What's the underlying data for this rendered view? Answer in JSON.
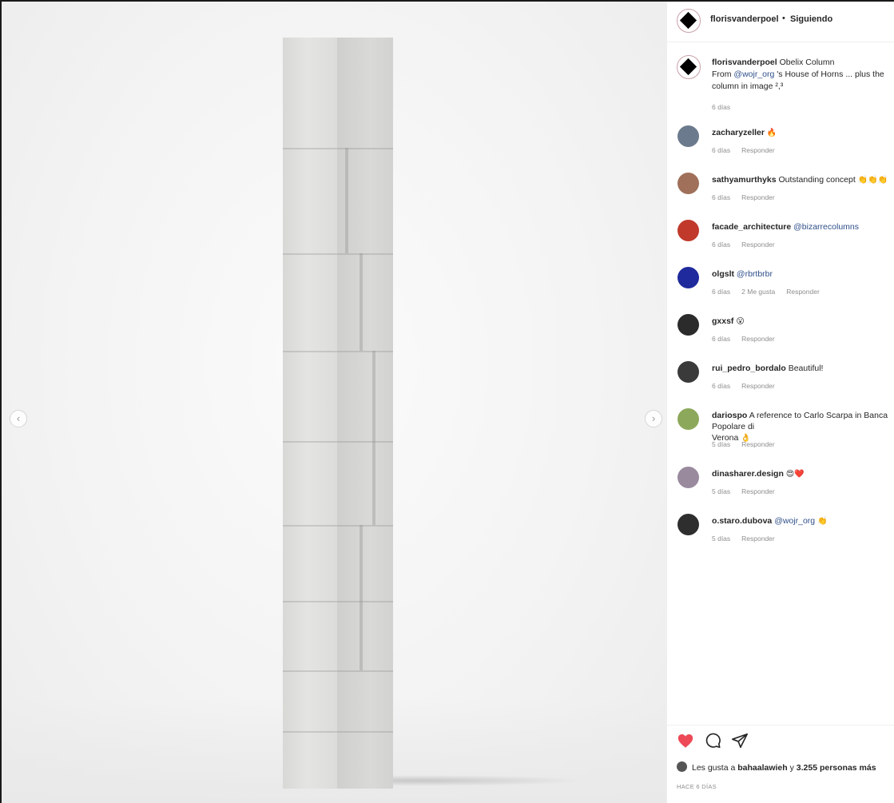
{
  "post": {
    "header": {
      "username": "florisvanderpoel",
      "separator": "•",
      "follow_status": "Siguiendo"
    },
    "caption": {
      "username": "florisvanderpoel",
      "title": "Obelix Column",
      "line2_prefix": "From ",
      "mention": "@wojr_org",
      "line2_rest": " 's House of Horns ... plus the",
      "line3": "column in image ²,³",
      "time": "6 días"
    },
    "comments": [
      {
        "username": "zacharyzeller",
        "text": "",
        "emoji": "🔥",
        "time": "6 días",
        "likes": "",
        "reply": "Responder",
        "avatar_color": "#6b7a8c"
      },
      {
        "username": "sathyamurthyks",
        "text": "Outstanding concept",
        "emoji": "👏👏👏",
        "time": "6 días",
        "likes": "",
        "reply": "Responder",
        "avatar_color": "#a0705a"
      },
      {
        "username": "facade_architecture",
        "text": "",
        "mention": "@bizarrecolumns",
        "time": "6 días",
        "likes": "",
        "reply": "Responder",
        "avatar_color": "#c0392b"
      },
      {
        "username": "olgslt",
        "text": "",
        "mention": "@rbrtbrbr",
        "time": "6 días",
        "likes": "2 Me gusta",
        "reply": "Responder",
        "avatar_color": "#1f2a9c"
      },
      {
        "username": "gxxsf",
        "text": "",
        "emoji": "😮",
        "time": "6 días",
        "likes": "",
        "reply": "Responder",
        "avatar_color": "#2b2b2b"
      },
      {
        "username": "rui_pedro_bordalo",
        "text": "Beautiful!",
        "time": "6 días",
        "likes": "",
        "reply": "Responder",
        "avatar_color": "#3a3a3a"
      },
      {
        "username": "dariospo",
        "text": "A reference to Carlo Scarpa in Banca Popolare di",
        "text2": "Verona",
        "emoji": "👌",
        "time": "5 días",
        "likes": "",
        "reply": "Responder",
        "avatar_color": "#8ca85a"
      },
      {
        "username": "dinasharer.design",
        "text": "",
        "emoji": "😍❤️",
        "time": "5 días",
        "likes": "",
        "reply": "Responder",
        "avatar_color": "#9a8a9e"
      },
      {
        "username": "o.staro.dubova",
        "text": "",
        "mention": "@wojr_org",
        "emoji": "👏",
        "time": "5 días",
        "likes": "",
        "reply": "Responder",
        "avatar_color": "#2e2e2e"
      }
    ],
    "actions": {
      "likes_prefix": "Les gusta a",
      "liker": "bahaalawieh",
      "likes_mid": "y",
      "likes_count": "3.255 personas más",
      "timestamp": "HACE 6 DÍAS"
    },
    "colors": {
      "heart": "#ed4956",
      "link": "#2f4f8a",
      "muted": "#8e8e8e"
    },
    "media": {
      "prev_icon": "chevron-left-icon",
      "next_icon": "chevron-right-icon",
      "prev_glyph": "‹",
      "next_glyph": "›"
    }
  }
}
